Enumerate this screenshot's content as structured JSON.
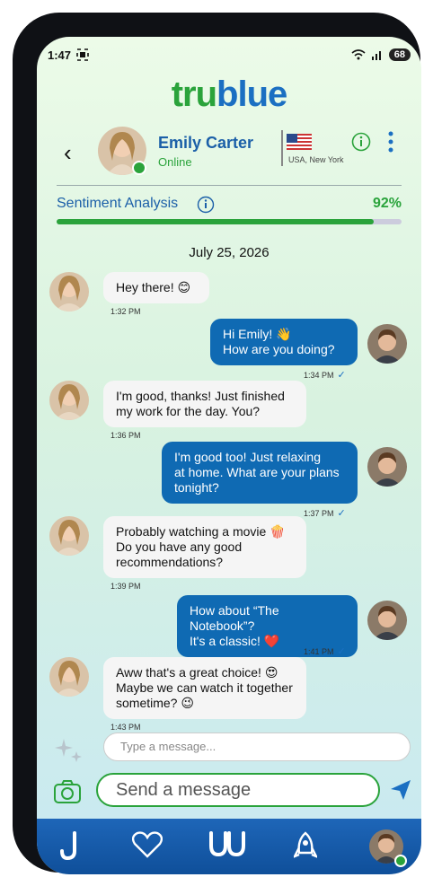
{
  "status": {
    "time": "1:47",
    "battery": "68"
  },
  "app": {
    "logo_green": "tru",
    "logo_blue": "blue"
  },
  "header": {
    "back_icon": "chevron-left-icon",
    "name": "Emily Carter",
    "presence": "Online",
    "location": "USA, New York"
  },
  "sentiment": {
    "label": "Sentiment Analysis",
    "value": "92%",
    "fraction": 0.92
  },
  "conversation": {
    "date": "July 25, 2026",
    "messages": [
      {
        "from": "her",
        "text": "Hey there! 😊",
        "time": "1:32 PM"
      },
      {
        "from": "me",
        "text": "Hi Emily! 👋\nHow are you doing?",
        "time": "1:34 PM"
      },
      {
        "from": "her",
        "text": "I'm good, thanks! Just finished\nmy work for the day. You?",
        "time": "1:36 PM"
      },
      {
        "from": "me",
        "text": "I'm good too! Just relaxing\nat home. What are your plans\ntonight?",
        "time": "1:37 PM"
      },
      {
        "from": "her",
        "text": "Probably watching a movie 🍿\nDo you have any good\nrecommendations?",
        "time": "1:39 PM"
      },
      {
        "from": "me",
        "text": "How about “The Notebook”?\nIt's a classic! ❤️",
        "time": "1:41 PM"
      },
      {
        "from": "her",
        "text": "Aww that's a great choice! 😍\nMaybe we can watch it together\nsometime? 😉",
        "time": "1:43 PM"
      }
    ]
  },
  "composer": {
    "suggest_placeholder": "Type a message...",
    "main_placeholder": "Send a message"
  },
  "colors": {
    "brand_green": "#2aa33b",
    "brand_blue": "#1b6fc2",
    "outgoing_bubble": "#0f6ab3"
  }
}
